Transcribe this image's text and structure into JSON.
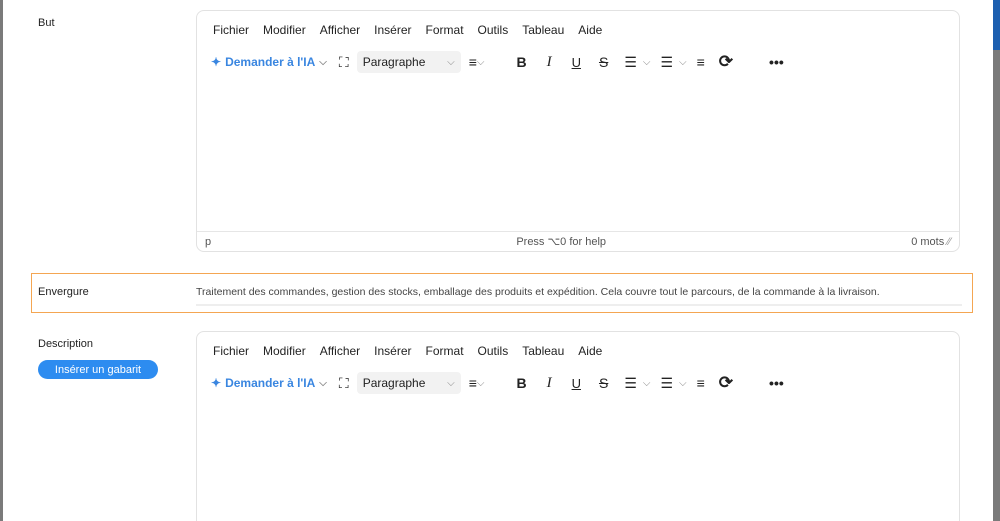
{
  "fields": {
    "but": {
      "label": "But"
    },
    "envergure": {
      "label": "Envergure",
      "value": "Traitement des commandes, gestion des stocks, emballage des produits et expédition. Cela couvre tout le parcours, de la commande à la livraison."
    },
    "description": {
      "label": "Description",
      "template_button": "Insérer un gabarit"
    }
  },
  "editor": {
    "menu": [
      "Fichier",
      "Modifier",
      "Afficher",
      "Insérer",
      "Format",
      "Outils",
      "Tableau",
      "Aide"
    ],
    "ai_label": "Demander à l'IA",
    "block_format": "Paragraphe",
    "status": {
      "path": "p",
      "help": "Press ⌥0 for help",
      "words": "0 mots"
    }
  },
  "colors": {
    "accent": "#3a86e0",
    "button": "#2d8cf0",
    "highlight_border": "#f4a652"
  }
}
